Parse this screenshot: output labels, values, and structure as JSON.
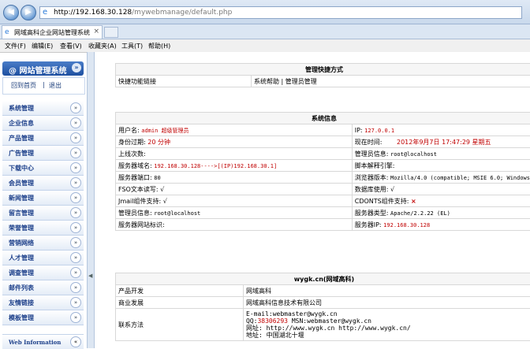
{
  "browser": {
    "url_host": "http://192.168.30.128",
    "url_path": "/mywebmanage/default.php",
    "tab_title": "网域高科企业网站管理系统",
    "menu": [
      "文件(F)",
      "编辑(E)",
      "查看(V)",
      "收藏夹(A)",
      "工具(T)",
      "帮助(H)"
    ]
  },
  "sidebar": {
    "title": "@ 网站管理系统",
    "home_link": "回到首页",
    "separator": "|",
    "logout_link": "退出",
    "items": [
      "系统管理",
      "企业信息",
      "产品管理",
      "广告管理",
      "下载中心",
      "会员管理",
      "新闻管理",
      "留言管理",
      "荣誉管理",
      "营销网络",
      "人才管理",
      "调查管理",
      "邮件列表",
      "友情链接",
      "模板管理"
    ],
    "web_info": "Web Information"
  },
  "shortcuts": {
    "title": "管理快捷方式",
    "label": "快捷功能链接",
    "link1": "系统帮助",
    "sep": "|",
    "link2": "管理员管理"
  },
  "sysinfo": {
    "title": "系统信息",
    "user_label": "用户名:",
    "user_value": "admin 超级管理员",
    "ip_label": "IP:",
    "ip_value": "127.0.0.1",
    "expire_label": "身份过期:",
    "expire_value": "20 分钟",
    "time_label": "现在时间:",
    "time_value": "2012年9月7日 17:47:29 星期五",
    "logins_label": "上线次数:",
    "admin_label": "管理员信息:",
    "admin_value": "root@localhost",
    "domain_label": "服务器域名:",
    "domain_value": "192.168.30.128---->[(IP)192.168.30.1]",
    "script_label": "脚本解释引擎:",
    "port_label": "服务器端口:",
    "port_value": "80",
    "browser_label": "浏览器版本:",
    "browser_value": "Mozilla/4.0 (compatible; MSIE 6.0; Windows",
    "fso_label": "FSO文本读写:",
    "fso_value": "√",
    "db_label": "数据库使用:",
    "db_value": "√",
    "jmail_label": "Jmail组件支持:",
    "jmail_value": "√",
    "cdonts_label": "CDONTS组件支持:",
    "cdonts_value": "×",
    "admin2_label": "管理员信息:",
    "admin2_value": "root@localhost",
    "server_type_label": "服务器类型:",
    "server_type_value": "Apache/2.2.22 (EL)",
    "server_id_label": "服务器网站标识:",
    "server_ip_label": "服务器IP:",
    "server_ip_value": "192.168.30.128"
  },
  "company": {
    "title": "wygk.cn(网域高科)",
    "dev_label": "产品开发",
    "dev_value": "网域高科",
    "biz_label": "商业发展",
    "biz_value": "网域高科信息技术有限公司",
    "contact_label": "联系方法",
    "email_line": "E-mail:webmaster@wygk.cn",
    "qq_prefix": "QQ:",
    "qq_value": "38306293",
    "msn_line": "MSN:webmaster@wygk.cn",
    "site_line": "网址: http://www.wygk.cn http://www.wygk.cn/",
    "addr_line": "地址: 中国湖北十堰"
  },
  "icons": [
    "back-icon",
    "forward-icon",
    "ie-icon",
    "close-icon",
    "collapse-icon"
  ]
}
